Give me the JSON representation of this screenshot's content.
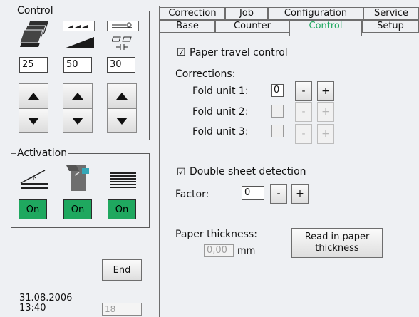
{
  "control_group": {
    "title": "Control",
    "fields": [
      "25",
      "50",
      "30"
    ]
  },
  "activation_group": {
    "title": "Activation",
    "buttons": [
      "On",
      "On",
      "On"
    ]
  },
  "end_button": "End",
  "datetime": {
    "date": "31.08.2006",
    "time": "13:40"
  },
  "footer_field": "18",
  "tabs_row1": [
    "Correction",
    "Job",
    "Configuration",
    "Service"
  ],
  "tabs_row2": [
    "Base",
    "Counter",
    "Control",
    "Setup"
  ],
  "active_tab": "Control",
  "paper_travel_label": "Paper travel control",
  "corrections": {
    "label": "Corrections:",
    "rows": [
      {
        "label": "Fold unit 1:",
        "value": "0"
      },
      {
        "label": "Fold unit 2:",
        "value": ""
      },
      {
        "label": "Fold unit 3:",
        "value": ""
      }
    ]
  },
  "double_sheet_label": "Double sheet detection",
  "factor": {
    "label": "Factor:",
    "value": "0"
  },
  "paper_thickness": {
    "label": "Paper thickness:",
    "value": "0,00",
    "unit": "mm"
  },
  "read_thickness_button": "Read in paper thickness",
  "symbols": {
    "minus": "-",
    "plus": "+",
    "check": "☑"
  },
  "icons": [
    "paper-stack-icon",
    "speed-ramp-icon",
    "fold-gap-icon",
    "sheet-feed-icon",
    "machine-unit-icon",
    "output-stack-icon",
    "arrow-up-icon",
    "arrow-down-icon"
  ]
}
